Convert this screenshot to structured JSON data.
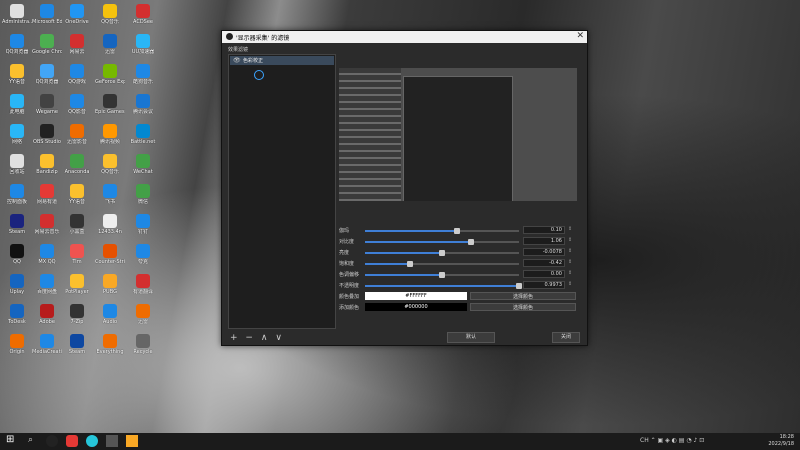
{
  "desktop": {
    "icons": [
      {
        "label": "Administra…",
        "color": "#e0e0e0"
      },
      {
        "label": "Microsoft Edge",
        "color": "#1e88e5"
      },
      {
        "label": "OneDrive",
        "color": "#2196f3"
      },
      {
        "label": "QQ音乐",
        "color": "#f4c20d"
      },
      {
        "label": "ACDSee",
        "color": "#d32f2f"
      },
      {
        "label": "QQ浏览器",
        "color": "#1e88e5"
      },
      {
        "label": "Google Chrome",
        "color": "#4caf50"
      },
      {
        "label": "网易云",
        "color": "#d32f2f"
      },
      {
        "label": "迅雷",
        "color": "#1565c0"
      },
      {
        "label": "UU加速器",
        "color": "#29b6f6"
      },
      {
        "label": "YY语音",
        "color": "#fbc02d"
      },
      {
        "label": "QQ浏览器",
        "color": "#42a5f5"
      },
      {
        "label": "QQ游戏",
        "color": "#1e88e5"
      },
      {
        "label": "GeForce Experience",
        "color": "#76b900"
      },
      {
        "label": "酷狗音乐",
        "color": "#1e88e5"
      },
      {
        "label": "此电脑",
        "color": "#29b6f6"
      },
      {
        "label": "Wegame",
        "color": "#424242"
      },
      {
        "label": "QQ影音",
        "color": "#1e88e5"
      },
      {
        "label": "Epic Games Launcher",
        "color": "#333"
      },
      {
        "label": "腾讯会议",
        "color": "#1976d2"
      },
      {
        "label": "网络",
        "color": "#29b6f6"
      },
      {
        "label": "OBS Studio",
        "color": "#222"
      },
      {
        "label": "迅雷影音",
        "color": "#ef6c00"
      },
      {
        "label": "腾讯视频",
        "color": "#ff9800"
      },
      {
        "label": "Battle.net",
        "color": "#0288d1"
      },
      {
        "label": "回收站",
        "color": "#e0e0e0"
      },
      {
        "label": "Bandizip",
        "color": "#fbc02d"
      },
      {
        "label": "Anaconda",
        "color": "#43a047"
      },
      {
        "label": "QQ音乐",
        "color": "#fbc02d"
      },
      {
        "label": "WeChat",
        "color": "#43a047"
      },
      {
        "label": "控制面板",
        "color": "#1e88e5"
      },
      {
        "label": "网易有道",
        "color": "#e53935"
      },
      {
        "label": "YY语音",
        "color": "#fbc02d"
      },
      {
        "label": "飞书",
        "color": "#1e88e5"
      },
      {
        "label": "微信",
        "color": "#43a047"
      },
      {
        "label": "Steam",
        "color": "#1a237e"
      },
      {
        "label": "网易云音乐",
        "color": "#d32f2f"
      },
      {
        "label": "小黑盒",
        "color": "#333"
      },
      {
        "label": "12433.4n",
        "color": "#eee"
      },
      {
        "label": "钉钉",
        "color": "#1e88e5"
      },
      {
        "label": "QQ",
        "color": "#111"
      },
      {
        "label": "MX QQ",
        "color": "#1e88e5"
      },
      {
        "label": "Tim",
        "color": "#ef5350"
      },
      {
        "label": "Counter-Strike Global Offensive",
        "color": "#e65100"
      },
      {
        "label": "夸克",
        "color": "#1e88e5"
      },
      {
        "label": "Uplay",
        "color": "#1565c0"
      },
      {
        "label": "百度网盘",
        "color": "#1e88e5"
      },
      {
        "label": "PotPlayer",
        "color": "#fbc02d"
      },
      {
        "label": "PUBG",
        "color": "#f9a825"
      },
      {
        "label": "有道翻译",
        "color": "#d32f2f"
      },
      {
        "label": "ToDesk",
        "color": "#1565c0"
      },
      {
        "label": "Adobe",
        "color": "#b71c1c"
      },
      {
        "label": "7-Zip",
        "color": "#333"
      },
      {
        "label": "Audio",
        "color": "#1e88e5"
      },
      {
        "label": "迅雷",
        "color": "#ef6c00"
      },
      {
        "label": "Origin",
        "color": "#ef6c00"
      },
      {
        "label": "MediaCreation",
        "color": "#1e88e5"
      },
      {
        "label": "Steam",
        "color": "#0d47a1"
      },
      {
        "label": "Everything",
        "color": "#ef6c00"
      },
      {
        "label": "Recycle",
        "color": "#666"
      }
    ]
  },
  "dialog": {
    "title": "'显示器采集' 的滤镜",
    "close_glyph": "✕",
    "filters_label": "效果滤镜",
    "filter_item": "色彩校正",
    "eye_glyph": "👁",
    "list_tools": {
      "add": "+",
      "remove": "−",
      "up": "∧",
      "down": "∨"
    },
    "controls": [
      {
        "label": "伽玛",
        "value": "0.10",
        "fraction": 0.6
      },
      {
        "label": "对比度",
        "value": "1.06",
        "fraction": 0.69
      },
      {
        "label": "亮度",
        "value": "-0.0078",
        "fraction": 0.5
      },
      {
        "label": "饱和度",
        "value": "-0.42",
        "fraction": 0.29
      },
      {
        "label": "色调偏移",
        "value": "0.00",
        "fraction": 0.5
      },
      {
        "label": "不透明度",
        "value": "0.9973",
        "fraction": 0.997
      }
    ],
    "colors": [
      {
        "label": "颜色叠加",
        "hex": "#FFFFFF",
        "swatch": "#ffffff",
        "text": "#000000",
        "button": "选择颜色"
      },
      {
        "label": "添加颜色",
        "hex": "#000000",
        "swatch": "#000000",
        "text": "#ffffff",
        "button": "选择颜色"
      }
    ],
    "defaults_button": "默认",
    "close_button": "关闭"
  },
  "taskbar": {
    "time": "18:28",
    "date": "2022/9/18",
    "tray_text": "CH"
  }
}
